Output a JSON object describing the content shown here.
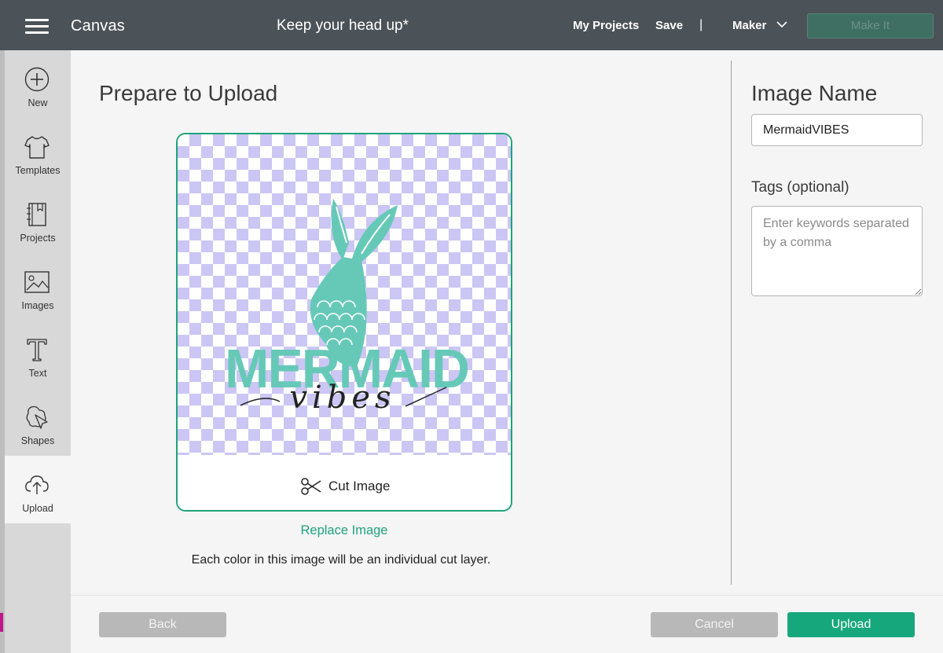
{
  "topbar": {
    "app_title": "Canvas",
    "project_title": "Keep your head up*",
    "my_projects": "My Projects",
    "save": "Save",
    "divider": "|",
    "machine": "Maker",
    "make_it": "Make It"
  },
  "sidebar": {
    "items": [
      {
        "label": "New",
        "icon": "plus-circle-icon"
      },
      {
        "label": "Templates",
        "icon": "tshirt-icon"
      },
      {
        "label": "Projects",
        "icon": "notebook-icon"
      },
      {
        "label": "Images",
        "icon": "image-icon"
      },
      {
        "label": "Text",
        "icon": "text-t-icon"
      },
      {
        "label": "Shapes",
        "icon": "shapes-icon"
      },
      {
        "label": "Upload",
        "icon": "cloud-upload-icon"
      }
    ],
    "active": "Upload"
  },
  "main": {
    "title": "Prepare to Upload",
    "cut_image_label": "Cut Image",
    "replace_image": "Replace Image",
    "hint": "Each color in this image will be an individual cut layer.",
    "artwork": {
      "title_text": "MERMAID",
      "script_text": "vibes"
    }
  },
  "right_panel": {
    "image_name_title": "Image Name",
    "image_name_value": "MermaidVIBES",
    "tags_label": "Tags (optional)",
    "tags_placeholder": "Enter keywords separated by a comma"
  },
  "footer": {
    "back": "Back",
    "cancel": "Cancel",
    "upload": "Upload"
  },
  "colors": {
    "topbar": "#4b5358",
    "accent": "#1fa37a",
    "artwork_teal": "#66c9b8",
    "checker": "#cbc6f3"
  }
}
